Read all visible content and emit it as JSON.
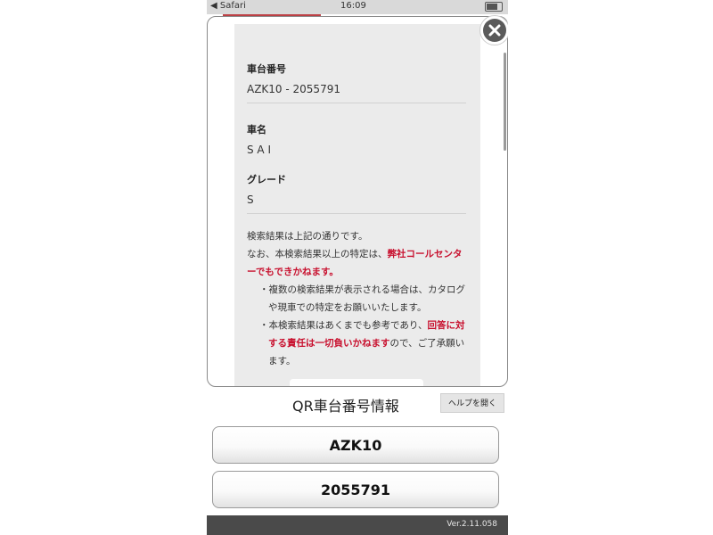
{
  "status_bar": {
    "carrier": "◀ Safari",
    "time": "16:09"
  },
  "modal": {
    "fields": [
      {
        "label": "車台番号",
        "value": "AZK10 - 2055791"
      },
      {
        "label": "車名",
        "value": "S A I"
      },
      {
        "label": "グレード",
        "value": "S"
      }
    ],
    "notice": {
      "line1": "検索結果は上記の通りです。",
      "line2_pre": "なお、本検索結果以上の特定は、",
      "line2_red": "弊社コールセンターでもできかねます。",
      "bullet1": "・複数の検索結果が表示される場合は、カタログや現車での特定をお願いいたします。",
      "bullet2_pre": "・本検索結果はあくまでも参考であり、",
      "bullet2_red": "回答に対する責任は一切負いかねます",
      "bullet2_post": "ので、ご了承願います。"
    }
  },
  "qr": {
    "title": "QR車台番号情報",
    "help_label": "ヘルプを開く",
    "model_code": "AZK10",
    "serial": "2055791"
  },
  "footer": {
    "version": "Ver.2.11.058"
  }
}
